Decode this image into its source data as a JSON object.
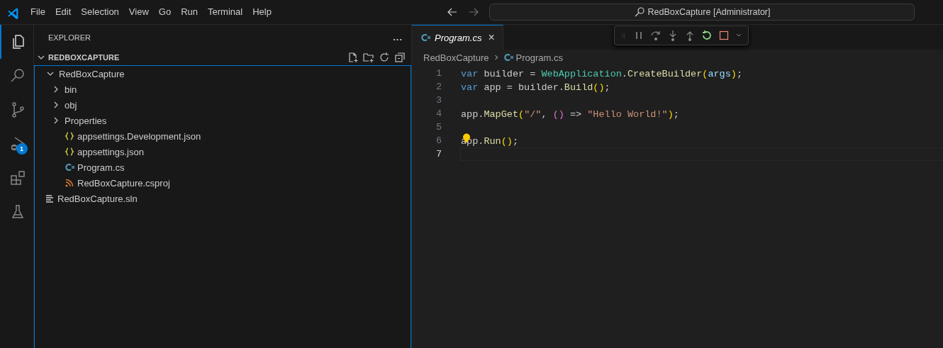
{
  "menu": [
    "File",
    "Edit",
    "Selection",
    "View",
    "Go",
    "Run",
    "Terminal",
    "Help"
  ],
  "command_center": {
    "title": "RedBoxCapture [Administrator]"
  },
  "activity_bar": [
    {
      "kind": "explorer",
      "selected": true
    },
    {
      "kind": "search",
      "selected": false
    },
    {
      "kind": "scm",
      "selected": false
    },
    {
      "kind": "debug",
      "selected": false,
      "badge": "1"
    },
    {
      "kind": "extensions",
      "selected": false
    },
    {
      "kind": "testing",
      "selected": false
    }
  ],
  "explorer": {
    "title": "EXPLORER",
    "more": "...",
    "section": {
      "title": "REDBOXCAPTURE",
      "expanded": true
    },
    "tree": [
      {
        "label": "RedBoxCapture",
        "kind": "folder",
        "expanded": true,
        "children": [
          {
            "label": "bin",
            "kind": "folder",
            "expanded": false
          },
          {
            "label": "obj",
            "kind": "folder",
            "expanded": false
          },
          {
            "label": "Properties",
            "kind": "folder",
            "expanded": false
          },
          {
            "label": "appsettings.Development.json",
            "kind": "json"
          },
          {
            "label": "appsettings.json",
            "kind": "json"
          },
          {
            "label": "Program.cs",
            "kind": "csharp"
          },
          {
            "label": "RedBoxCapture.csproj",
            "kind": "csproj"
          }
        ]
      },
      {
        "label": "RedBoxCapture.sln",
        "kind": "sln"
      }
    ]
  },
  "editor": {
    "tabs": [
      {
        "label": "Program.cs",
        "selected": true,
        "close": "×"
      }
    ],
    "breadcrumb": [
      "RedBoxCapture",
      "Program.cs"
    ],
    "lines": [
      {
        "number": "1",
        "current": false,
        "tokens": [
          {
            "t": "var",
            "kind": "keyword"
          },
          {
            "t": " builder = ",
            "kind": "plain"
          },
          {
            "t": "WebApplication",
            "kind": "type"
          },
          {
            "t": ".",
            "kind": "plain"
          },
          {
            "t": "CreateBuilder",
            "kind": "method"
          },
          {
            "t": "(",
            "kind": "paren"
          },
          {
            "t": "args",
            "kind": "param"
          },
          {
            "t": ")",
            "kind": "paren"
          },
          {
            "t": ";",
            "kind": "plain"
          }
        ]
      },
      {
        "number": "2",
        "current": false,
        "tokens": [
          {
            "t": "var",
            "kind": "keyword"
          },
          {
            "t": " app = builder.",
            "kind": "plain"
          },
          {
            "t": "Build",
            "kind": "method"
          },
          {
            "t": "()",
            "kind": "paren"
          },
          {
            "t": ";",
            "kind": "plain"
          }
        ]
      },
      {
        "number": "3",
        "current": false
      },
      {
        "number": "4",
        "current": false,
        "tokens": [
          {
            "t": "app.",
            "kind": "plain"
          },
          {
            "t": "MapGet",
            "kind": "method"
          },
          {
            "t": "(",
            "kind": "paren"
          },
          {
            "t": "\"/\"",
            "kind": "string"
          },
          {
            "t": ", ",
            "kind": "plain"
          },
          {
            "t": "()",
            "kind": "paren2"
          },
          {
            "t": " => ",
            "kind": "plain"
          },
          {
            "t": "\"Hello World!\"",
            "kind": "string"
          },
          {
            "t": ")",
            "kind": "paren"
          },
          {
            "t": ";",
            "kind": "plain"
          }
        ]
      },
      {
        "number": "5",
        "current": false
      },
      {
        "number": "6",
        "current": false,
        "lightbulb": true,
        "tokens": [
          {
            "t": "app.",
            "kind": "plain"
          },
          {
            "t": "Run",
            "kind": "method"
          },
          {
            "t": "()",
            "kind": "paren"
          },
          {
            "t": ";",
            "kind": "plain"
          }
        ]
      },
      {
        "number": "7",
        "current": true
      }
    ]
  }
}
